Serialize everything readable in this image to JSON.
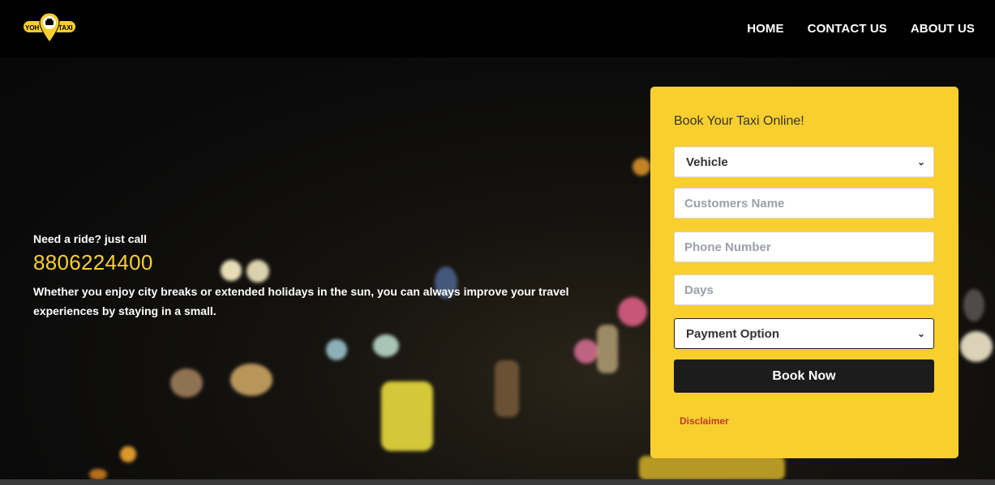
{
  "nav": {
    "logo_text_left": "YOH",
    "logo_text_right": "TAXI",
    "links": [
      "HOME",
      "CONTACT US",
      "ABOUT US"
    ]
  },
  "hero": {
    "need_ride": "Need a ride? just call",
    "phone": "8806224400",
    "description": "Whether you enjoy city breaks or extended holidays in the sun, you can always improve your travel experiences by staying in a small."
  },
  "booking": {
    "title": "Book Your Taxi Online!",
    "vehicle_select": "Vehicle",
    "name_placeholder": "Customers Name",
    "phone_placeholder": "Phone Number",
    "days_placeholder": "Days",
    "payment_select": "Payment Option",
    "submit_label": "Book Now",
    "disclaimer": "Disclaimer"
  },
  "colors": {
    "accent": "#f9cf2f",
    "button": "#1c1c1c",
    "disclaimer": "#c0392b"
  }
}
